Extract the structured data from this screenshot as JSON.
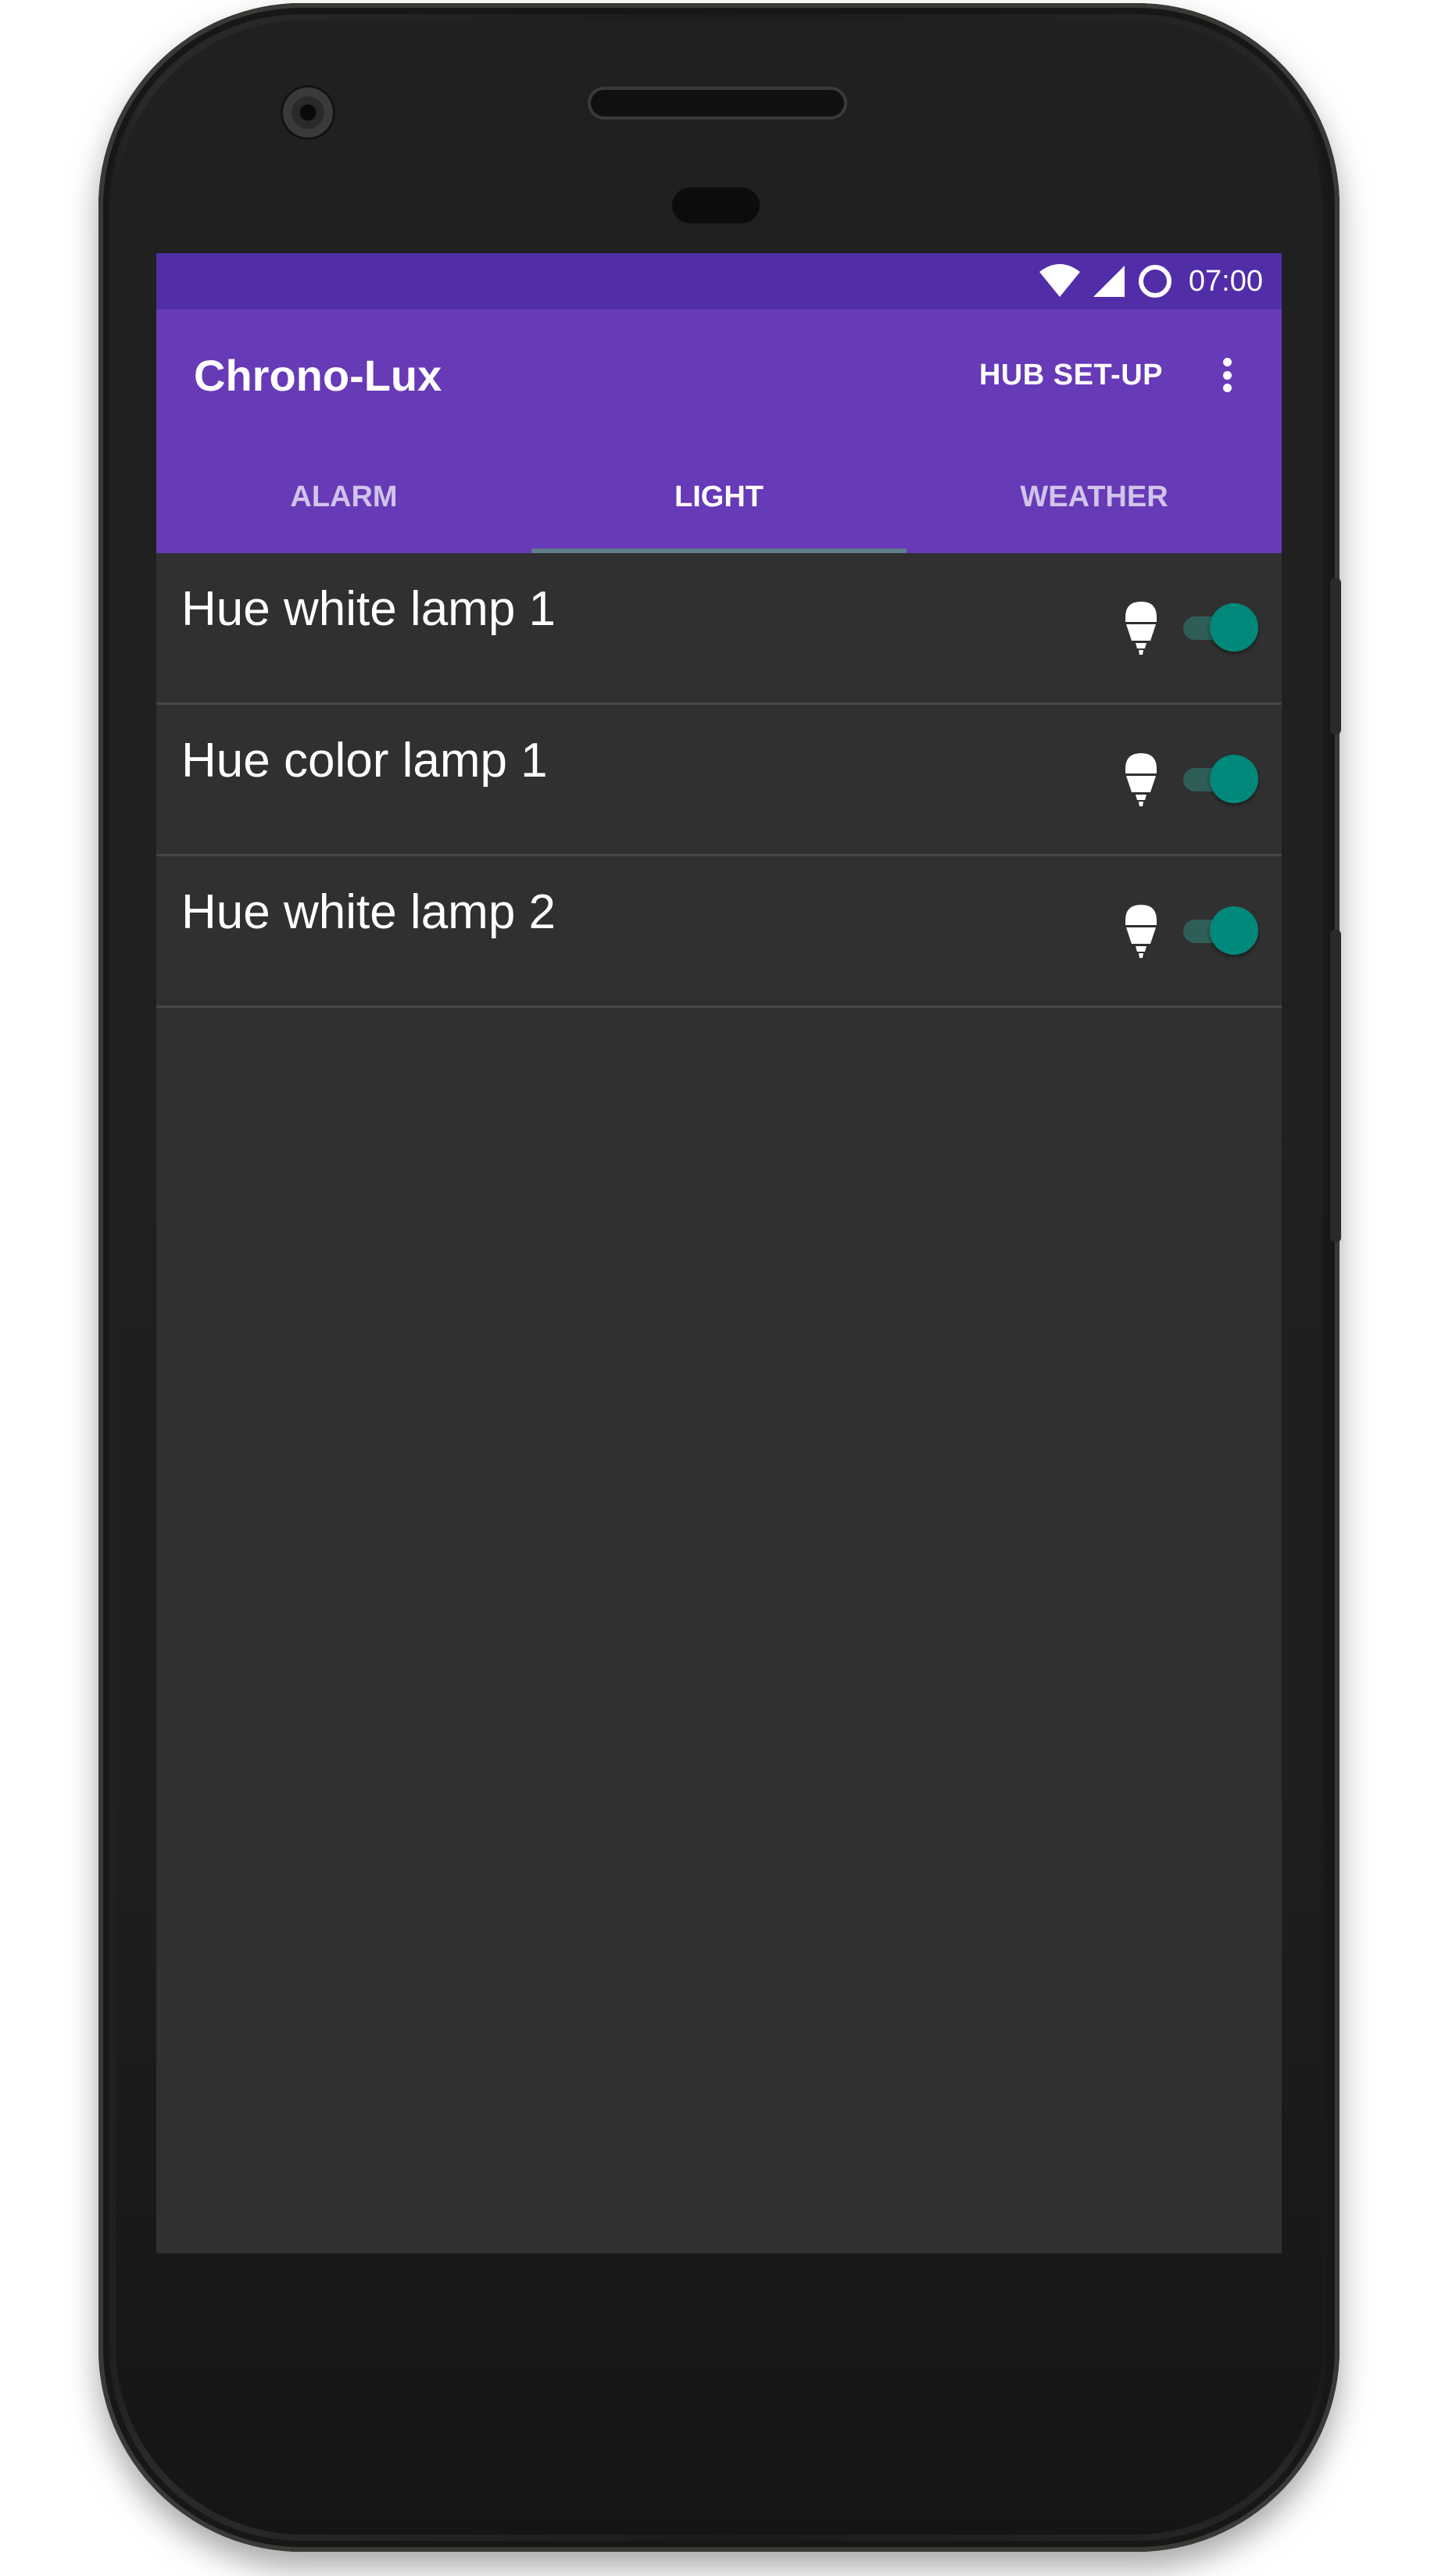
{
  "status_bar": {
    "time": "07:00",
    "icons": [
      "wifi-icon",
      "cell-signal-icon",
      "battery-ring-icon"
    ]
  },
  "toolbar": {
    "title": "Chrono-Lux",
    "hub_setup_label": "HUB SET-UP",
    "overflow_icon": "more-vert-icon"
  },
  "tabs": [
    {
      "label": "ALARM",
      "active": false
    },
    {
      "label": "LIGHT",
      "active": true
    },
    {
      "label": "WEATHER",
      "active": false
    }
  ],
  "lights": [
    {
      "name": "Hue white lamp 1",
      "icon": "bulb-icon",
      "on": true
    },
    {
      "name": "Hue color lamp 1",
      "icon": "bulb-icon",
      "on": true
    },
    {
      "name": "Hue white lamp 2",
      "icon": "bulb-icon",
      "on": true
    }
  ],
  "colors": {
    "status_bar": "#512da8",
    "toolbar": "#673ab7",
    "tab_indicator": "#607d8b",
    "screen_background": "#303030",
    "switch_accent": "#00897b"
  }
}
